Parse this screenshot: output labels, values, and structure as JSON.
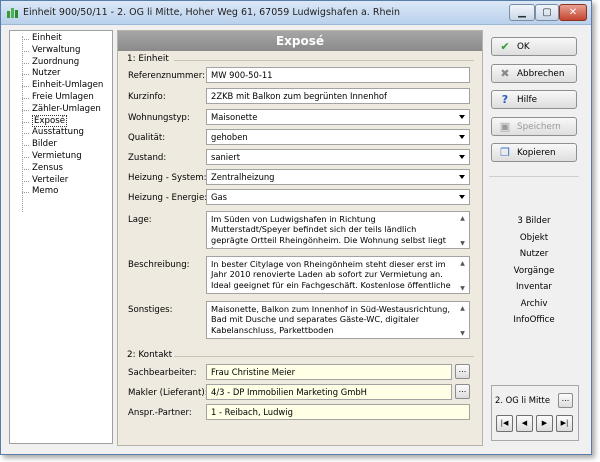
{
  "window": {
    "title": "Einheit 900/50/11 - 2. OG li Mitte, Hoher Weg 61, 67059 Ludwigshafen a. Rhein",
    "min_glyph": "▁",
    "max_glyph": "▢",
    "close_glyph": "✕"
  },
  "nav": {
    "items": [
      "Einheit",
      "Verwaltung",
      "Zuordnung",
      "Nutzer",
      "Einheit-Umlagen",
      "Freie Umlagen",
      "Zähler-Umlagen",
      "Exposé",
      "Ausstattung",
      "Bilder",
      "Vermietung",
      "Zensus",
      "Verteiler",
      "Memo"
    ],
    "selected": "Exposé"
  },
  "expose": {
    "header": "Exposé",
    "section1": "1: Einheit",
    "labels": {
      "ref": "Referenznummer:",
      "kurz": "Kurzinfo:",
      "typ": "Wohnungstyp:",
      "qual": "Qualität:",
      "zust": "Zustand:",
      "heiz_sys": "Heizung - System:",
      "heiz_en": "Heizung - Energie:",
      "lage": "Lage:",
      "beschr": "Beschreibung:",
      "sonst": "Sonstiges:"
    },
    "values": {
      "ref": "MW 900-50-11",
      "kurz": "2ZKB mit Balkon zum begrünten Innenhof",
      "typ": "Maisonette",
      "qual": "gehoben",
      "zust": "saniert",
      "heiz_sys": "Zentralheizung",
      "heiz_en": "Gas",
      "lage": "Im Süden von Ludwigshafen in Richtung Mutterstadt/Speyer befindet sich der teils ländlich geprägte Ortteil Rheingönheim. Die Wohnung selbst liegt im",
      "beschr": "In bester Citylage von Rheingönheim steht dieser erst im Jahr 2010 renovierte Laden ab sofort zur Vermietung an. Ideal geeignet für ein Fachgeschäft. Kostenlose öffentliche",
      "sonst": "Maisonette, Balkon zum Innenhof in Süd-Westausrichtung, Bad mit Dusche und separates Gäste-WC, digitaler Kabelanschluss, Parkettboden"
    },
    "section2": "2: Kontakt",
    "contact_labels": {
      "sach": "Sachbearbeiter:",
      "makler": "Makler (Lieferant):",
      "anspr": "Anspr.-Partner:"
    },
    "contact_values": {
      "sach": "Frau Christine Meier",
      "makler": "4/3 - DP Immobilien Marketing GmbH",
      "anspr": "1 - Reibach, Ludwig"
    },
    "dots": "..."
  },
  "buttons": {
    "ok": "OK",
    "cancel": "Abbrechen",
    "help": "Hilfe",
    "save": "Speichern",
    "copy": "Kopieren"
  },
  "icons": {
    "ok": "✔",
    "cancel": "✖",
    "help": "?",
    "save": "▣",
    "copy": "❐"
  },
  "links": [
    "3 Bilder",
    "Objekt",
    "Nutzer",
    "Vorgänge",
    "Inventar",
    "Archiv",
    "InfoOffice"
  ],
  "record": {
    "label": "2. OG li Mitte",
    "dots": "...",
    "first": "|◀",
    "prev": "◀",
    "next": "▶",
    "last": "▶|"
  },
  "scroll": {
    "up": "▲",
    "down": "▼"
  },
  "colors": {
    "ok_icon": "#2e9a2e",
    "cancel_icon": "#8a8a8a",
    "help_icon": "#2a5fc0",
    "save_icon": "#9a9a9a",
    "copy_icon": "#3b76c8"
  }
}
